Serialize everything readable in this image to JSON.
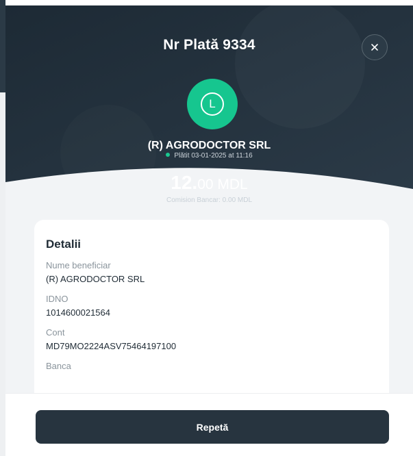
{
  "payment": {
    "title": "Nr Plată 9334",
    "avatar_initial": "L",
    "beneficiary_name": "(R) AGRODOCTOR SRL",
    "status_text": "Plătit 03-01-2025 at 11:16",
    "amount_integer": "12.",
    "amount_decimal": "00",
    "currency": "MDL",
    "commission": "Comision Bancar: 0.00 MDL"
  },
  "details": {
    "title": "Detalii",
    "fields": [
      {
        "label": "Nume beneficiar",
        "value": "(R) AGRODOCTOR SRL"
      },
      {
        "label": "IDNO",
        "value": "1014600021564"
      },
      {
        "label": "Cont",
        "value": "MD79MO2224ASV75464197100"
      },
      {
        "label": "Banca",
        "value": ""
      }
    ]
  },
  "actions": {
    "repeat_label": "Repetă",
    "close_icon": "close-icon"
  },
  "colors": {
    "header_bg": "#22313d",
    "accent_green": "#16c68f",
    "button_bg": "#27343f",
    "panel_bg": "#f2f4f6"
  }
}
